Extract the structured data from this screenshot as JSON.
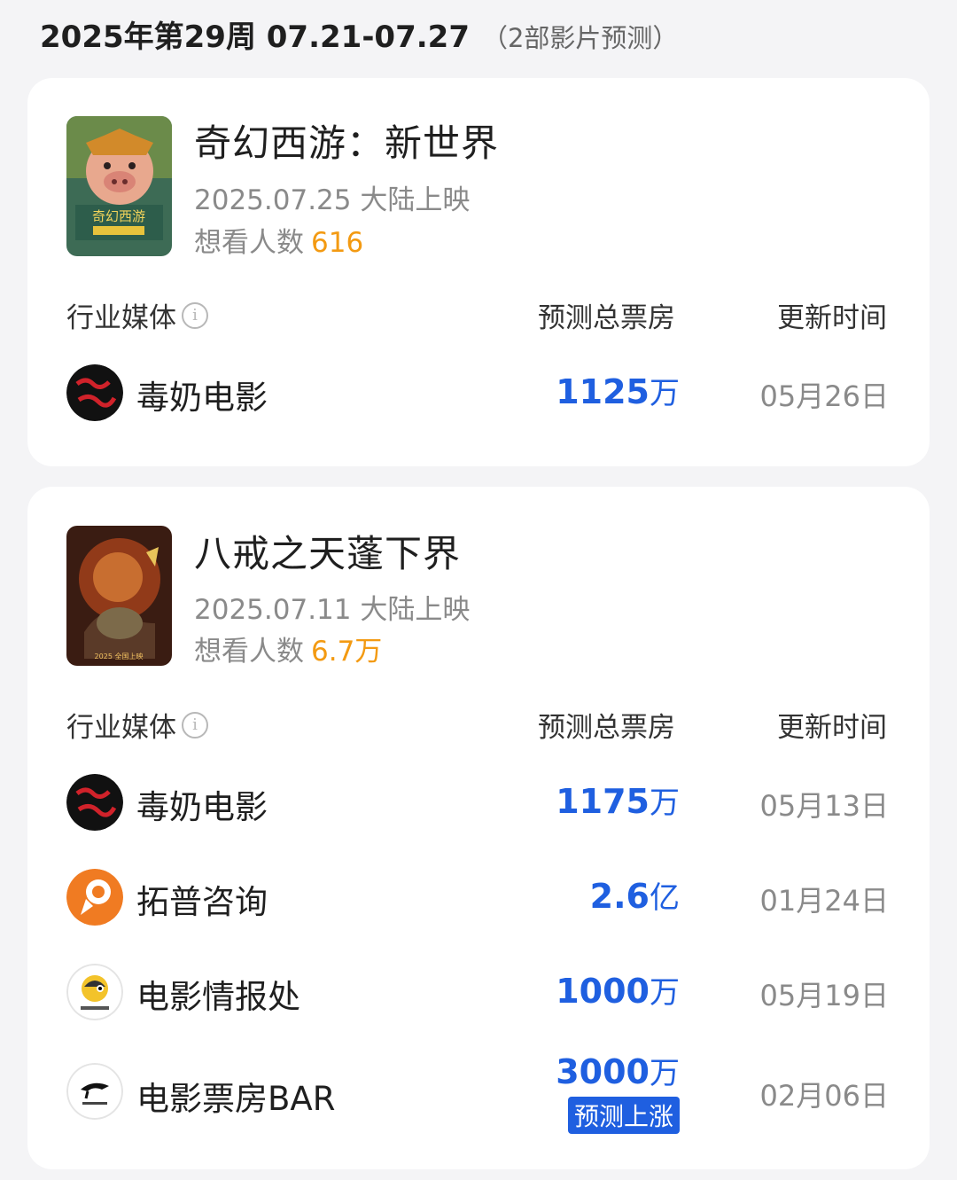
{
  "week": {
    "title": "2025年第29周 07.21-07.27",
    "subtitle": "（2部影片预测）"
  },
  "table_headers": {
    "media": "行业媒体",
    "box_office": "预测总票房",
    "update_time": "更新时间"
  },
  "movies": [
    {
      "title": "奇幻西游：新世界",
      "release": "2025.07.25 大陆上映",
      "want_label": "想看人数",
      "want_count": "616",
      "poster_text": "奇幻西游",
      "predictions": [
        {
          "media": "毒奶电影",
          "value": "1125",
          "unit": "万",
          "date": "05月26日"
        }
      ]
    },
    {
      "title": "八戒之天蓬下界",
      "release": "2025.07.11 大陆上映",
      "want_label": "想看人数",
      "want_count": "6.7万",
      "poster_text": "2025 全国上映",
      "predictions": [
        {
          "media": "毒奶电影",
          "value": "1175",
          "unit": "万",
          "date": "05月13日"
        },
        {
          "media": "拓普咨询",
          "value": "2.6",
          "unit": "亿",
          "date": "01月24日"
        },
        {
          "media": "电影情报处",
          "value": "1000",
          "unit": "万",
          "date": "05月19日"
        },
        {
          "media": "电影票房BAR",
          "value": "3000",
          "unit": "万",
          "date": "02月06日",
          "tag": "预测上涨"
        }
      ]
    }
  ],
  "colors": {
    "accent_blue": "#1f5fe0",
    "want_orange": "#f39a12",
    "muted": "#8a8a8a"
  },
  "icons": [
    "info-icon",
    "dunai-logo",
    "topu-logo",
    "qingbao-logo",
    "bar-logo"
  ]
}
